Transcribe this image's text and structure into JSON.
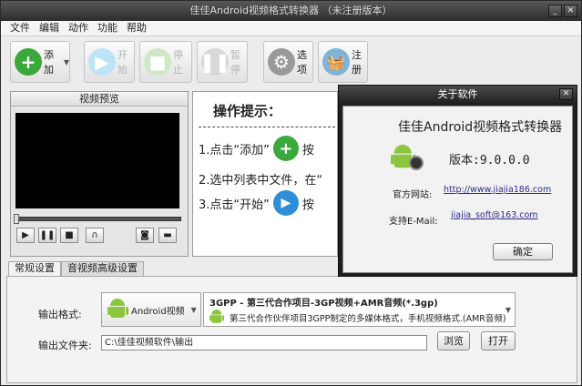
{
  "window": {
    "title": "佳佳Android视频格式转换器 （未注册版本）"
  },
  "menu": [
    "文件",
    "编辑",
    "动作",
    "功能",
    "帮助"
  ],
  "toolbar": {
    "add": "添加",
    "start": "开始",
    "stop": "停止",
    "pause": "暂停",
    "options": "选项",
    "register": "注册"
  },
  "preview": {
    "title": "视频预览"
  },
  "tips": {
    "title": "操作提示：",
    "line1": "1.点击“添加”",
    "line1_tail": "按",
    "line2": "2.选中列表中文件，在“",
    "line3": "3.点击“开始”",
    "line3_tail": "按"
  },
  "tabs": [
    "常规设置",
    "音视频高级设置"
  ],
  "settings": {
    "format_label": "输出格式:",
    "format_value": "Android视频",
    "profile_title": "3GPP - 第三代合作项目-3GP视频+AMR音频(*.3gp)",
    "profile_desc": "第三代合作伙伴项目3GPP制定的多媒体格式，手机视频格式.(AMR音频)",
    "folder_label": "输出文件夹:",
    "folder_value": "C:\\佳佳视频软件\\输出",
    "browse": "浏览",
    "open": "打开"
  },
  "about": {
    "title": "关于软件",
    "app_name": "佳佳Android视频格式转换器",
    "version": "版本:9.0.0.0",
    "website_label": "官方网站:",
    "website": "http://www.jiajia186.com",
    "email_label": "支持E-Mail:",
    "email": "jiajia_soft@163.com",
    "ok": "确定"
  },
  "colors": {
    "green": "#3aa83a",
    "blue": "#2e8fd8",
    "android": "#8cc63f"
  }
}
